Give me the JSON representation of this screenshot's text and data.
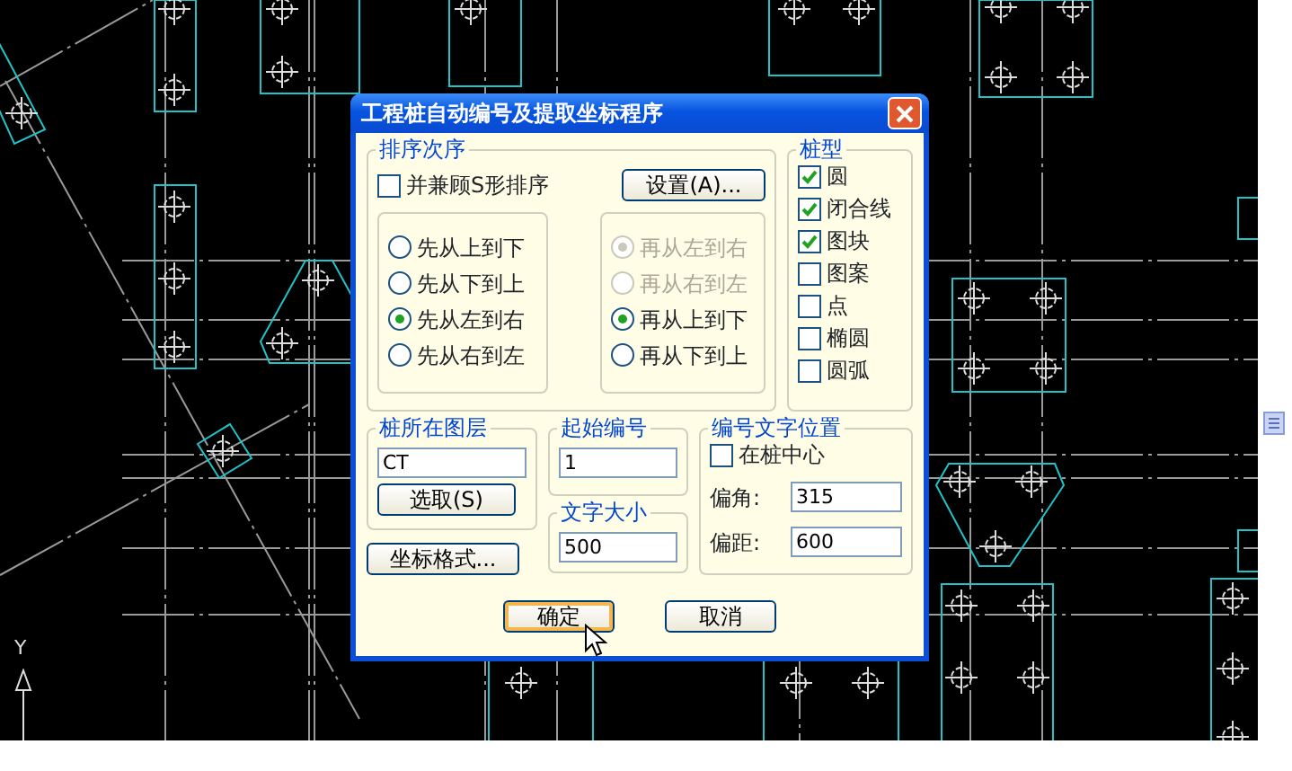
{
  "window": {
    "title": "工程桩自动编号及提取坐标程序"
  },
  "cad": {
    "axis_label": "Y"
  },
  "sort_order": {
    "label": "排序次序",
    "s_shape": {
      "label": "并兼顾S形排序",
      "checked": false
    },
    "settings_button": "设置(A)...",
    "primary": [
      {
        "label": "先从上到下",
        "selected": false
      },
      {
        "label": "先从下到上",
        "selected": false
      },
      {
        "label": "先从左到右",
        "selected": true
      },
      {
        "label": "先从右到左",
        "selected": false
      }
    ],
    "secondary": [
      {
        "label": "再从左到右",
        "selected": true,
        "disabled": true
      },
      {
        "label": "再从右到左",
        "selected": false,
        "disabled": true
      },
      {
        "label": "再从上到下",
        "selected": true,
        "disabled": false
      },
      {
        "label": "再从下到上",
        "selected": false,
        "disabled": false
      }
    ]
  },
  "pile_type": {
    "label": "桩型",
    "options": [
      {
        "label": "圆",
        "checked": true
      },
      {
        "label": "闭合线",
        "checked": true
      },
      {
        "label": "图块",
        "checked": true
      },
      {
        "label": "图案",
        "checked": false
      },
      {
        "label": "点",
        "checked": false
      },
      {
        "label": "椭圆",
        "checked": false
      },
      {
        "label": "圆弧",
        "checked": false
      }
    ]
  },
  "layer": {
    "label": "桩所在图层",
    "value": "CT",
    "pick_button": "选取(S)"
  },
  "coord_format_button": "坐标格式...",
  "start_number": {
    "label": "起始编号",
    "value": "1"
  },
  "text_size": {
    "label": "文字大小",
    "value": "500"
  },
  "label_position": {
    "label": "编号文字位置",
    "at_center": {
      "label": "在桩中心",
      "checked": false
    },
    "angle": {
      "label": "偏角:",
      "value": "315"
    },
    "offset": {
      "label": "偏距:",
      "value": "600"
    }
  },
  "buttons": [
    {
      "label": "确定",
      "focused": true
    },
    {
      "label": "取消",
      "focused": false
    }
  ]
}
